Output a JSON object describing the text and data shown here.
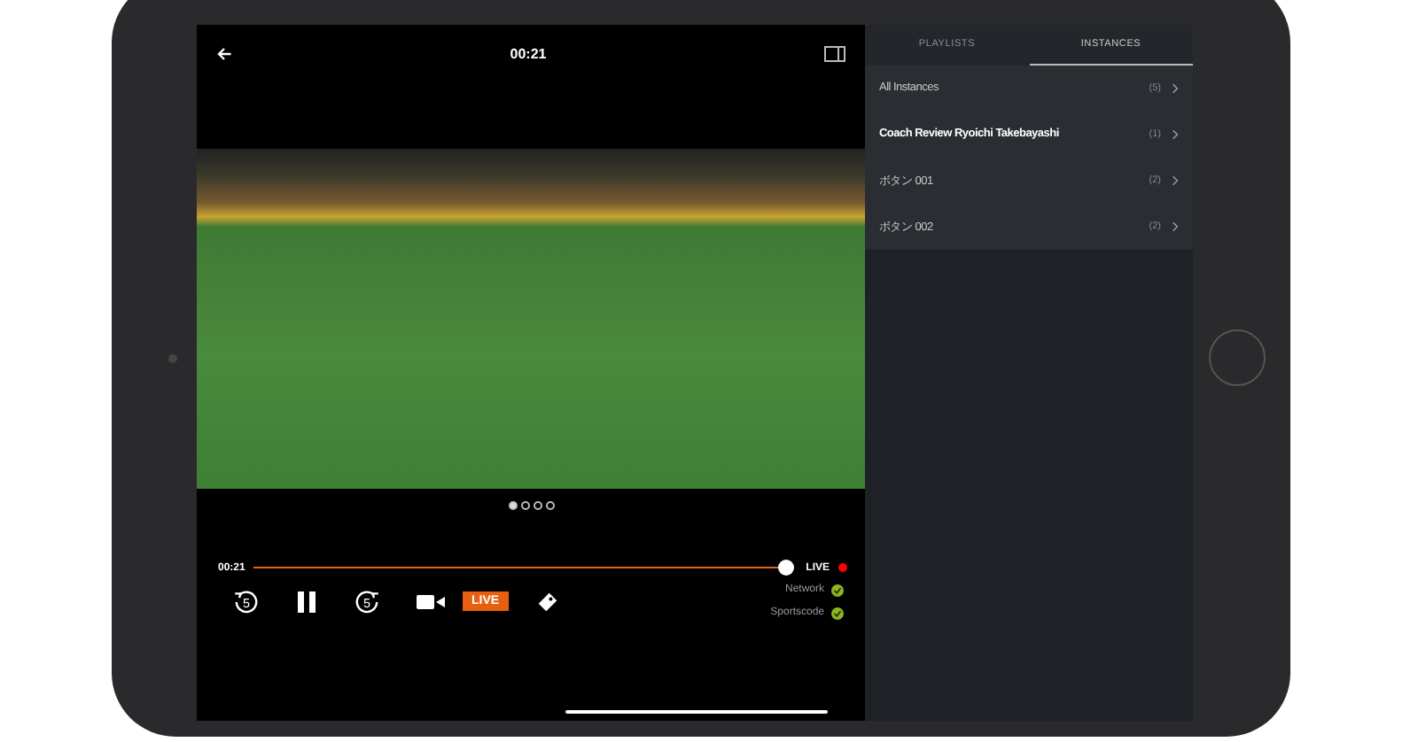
{
  "player": {
    "time": "00:21",
    "current_time": "00:21",
    "level": 1.0,
    "live_label": "LIVE",
    "live_button": "LIVE",
    "skip_back": "5",
    "skip_forward": "5"
  },
  "pager": [
    {
      "selected": true
    },
    {
      "selected": false
    },
    {
      "selected": false
    },
    {
      "selected": false
    }
  ],
  "status": [
    {
      "label": "Network",
      "ok": true
    },
    {
      "label": "Sportscode",
      "ok": true
    }
  ],
  "tabs": [
    {
      "label": "PLAYLISTS",
      "selected": false
    },
    {
      "label": "INSTANCES",
      "selected": true
    }
  ],
  "instances": [
    {
      "name": "All Instances",
      "count": "(5)",
      "bold": false
    },
    {
      "name": "Coach Review Ryoichi Takebayashi",
      "count": "(1)",
      "bold": true
    },
    {
      "name": "ボタン 001",
      "count": "(2)",
      "bold": false
    },
    {
      "name": "ボタン 002",
      "count": "(2)",
      "bold": false
    }
  ]
}
